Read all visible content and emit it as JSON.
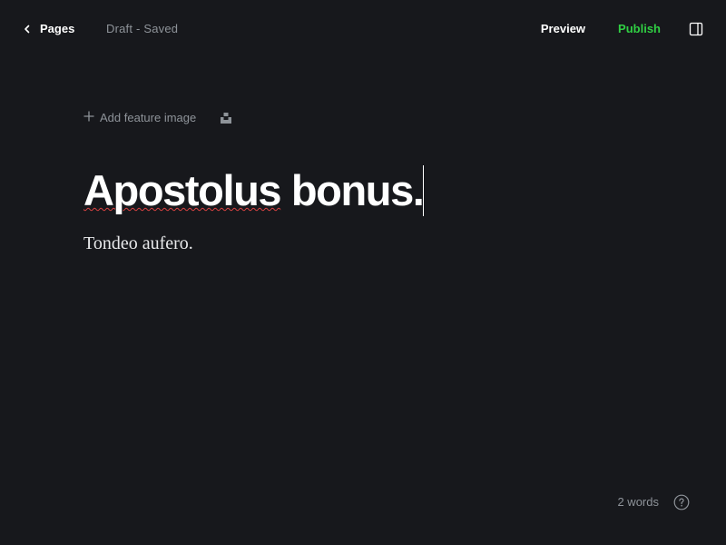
{
  "header": {
    "back_label": "Pages",
    "status": "Draft - Saved",
    "preview_label": "Preview",
    "publish_label": "Publish",
    "icons": {
      "back": "chevron-left-icon",
      "sidebar": "sidebar-toggle-icon"
    }
  },
  "editor": {
    "add_feature_label": "Add feature image",
    "title_word_misspelled": "Apostolus",
    "title_rest": " bonus.",
    "body": "Tondeo aufero.",
    "icons": {
      "add": "plus-icon",
      "unsplash": "unsplash-icon"
    }
  },
  "footer": {
    "word_count": "2 words",
    "help_icon": "help-circle-icon"
  },
  "colors": {
    "background": "#17181c",
    "text": "#ffffff",
    "muted": "#8e9399",
    "accent_green": "#30cf43",
    "spell_error": "#d94242"
  }
}
